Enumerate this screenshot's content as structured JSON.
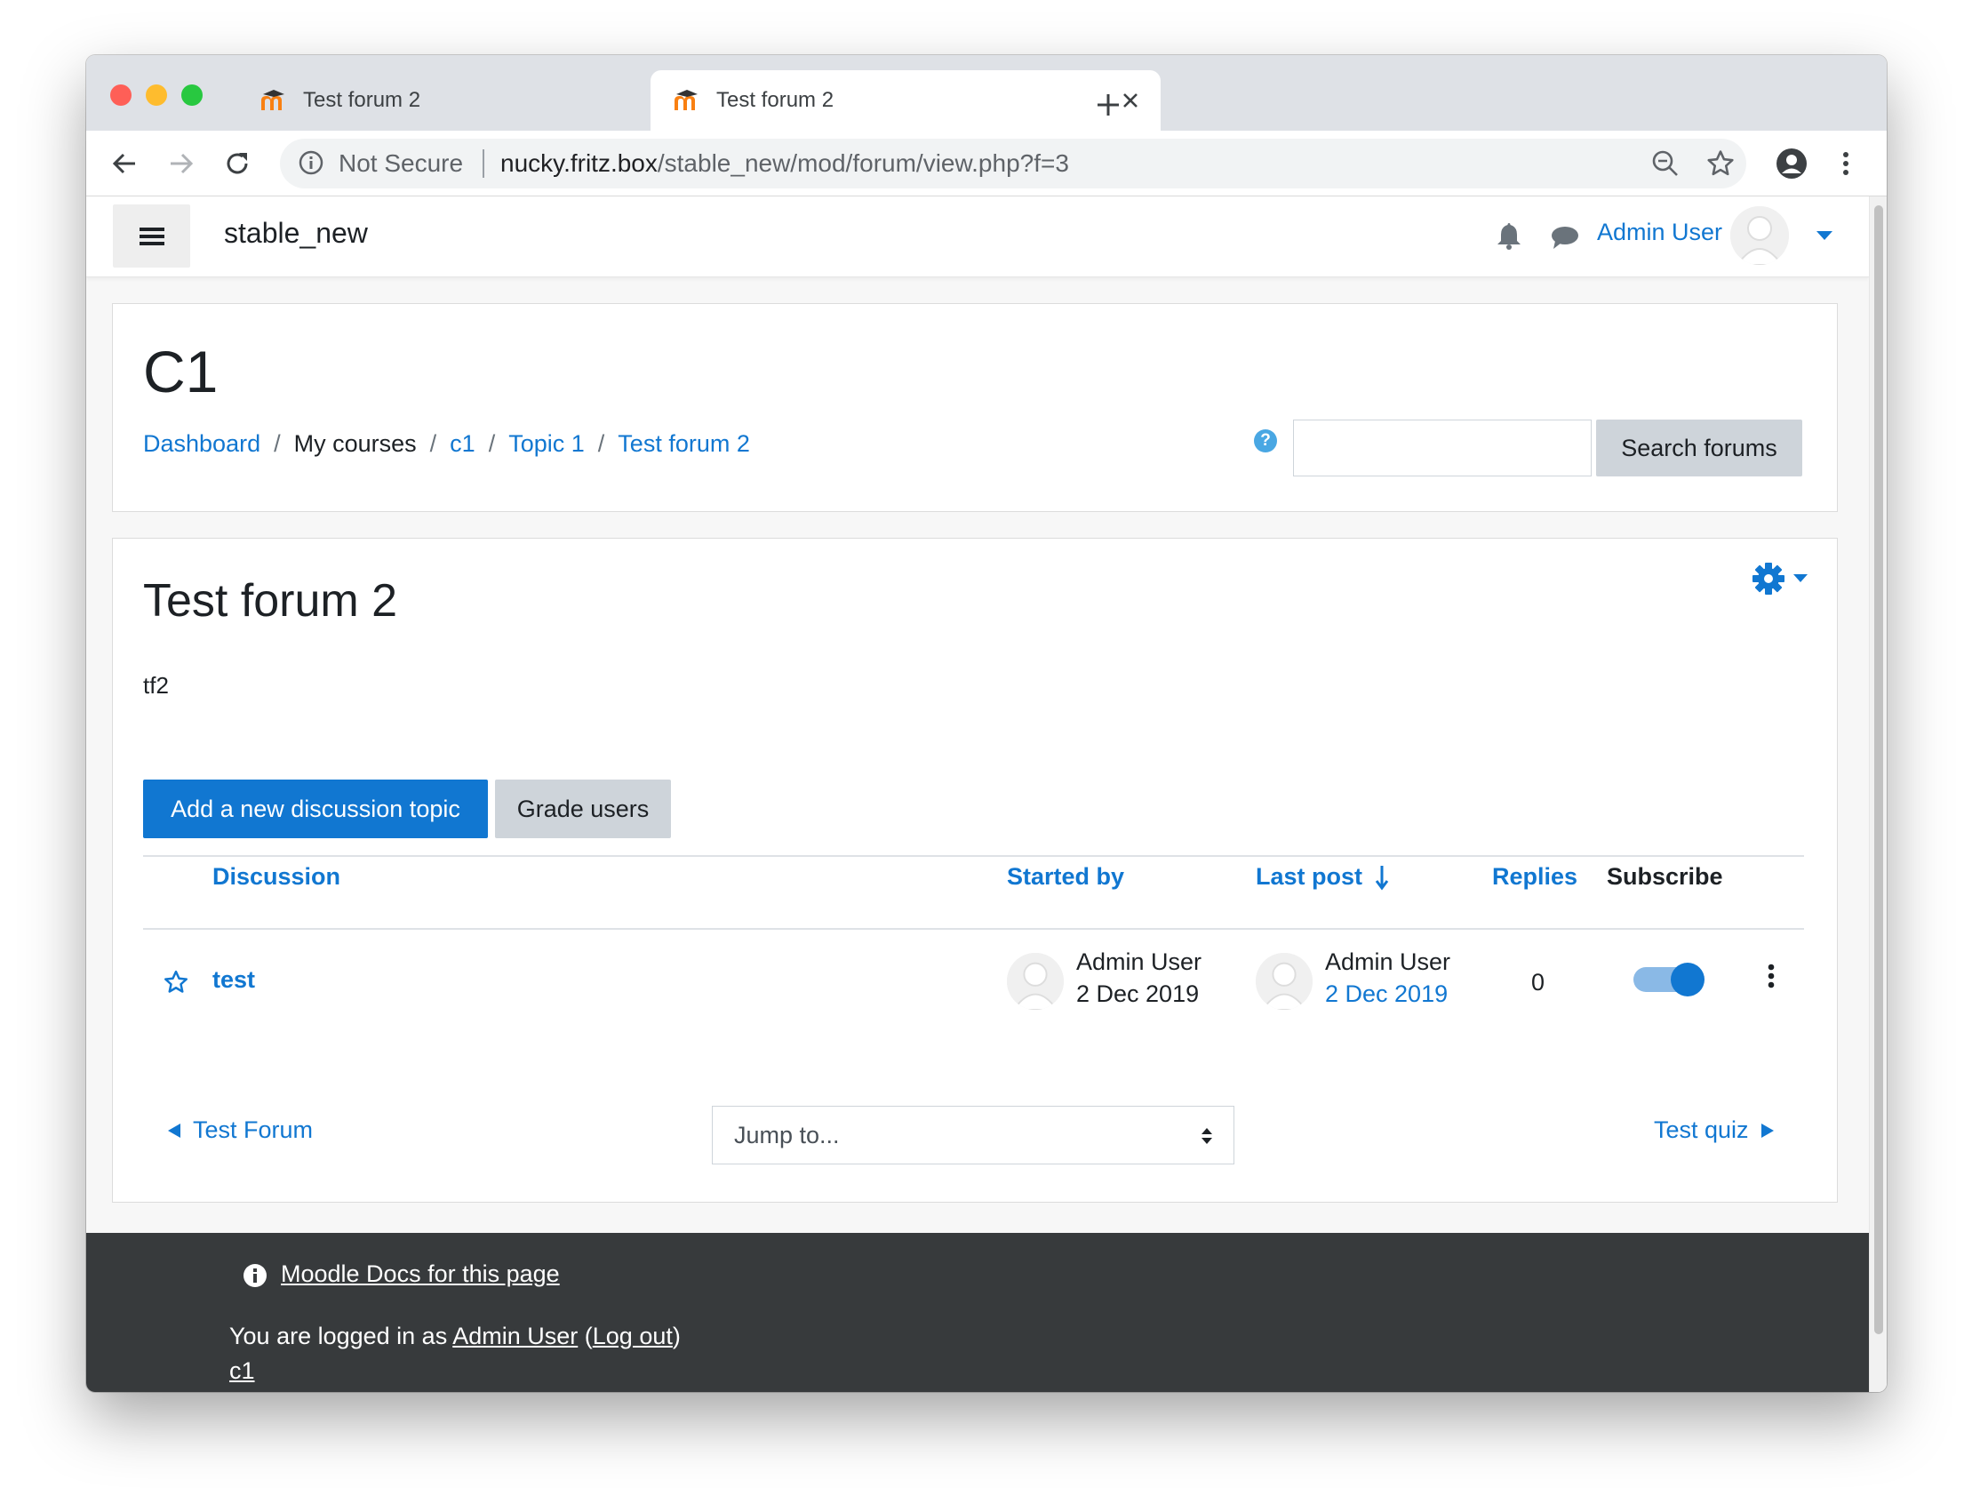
{
  "browser": {
    "tabs": [
      {
        "title": "Test forum 2"
      },
      {
        "title": "Test forum 2"
      }
    ],
    "address": {
      "security_label": "Not Secure",
      "host": "nucky.fritz.box",
      "path": "/stable_new/mod/forum/view.php?f=3"
    }
  },
  "navbar": {
    "site_name": "stable_new",
    "user_name": "Admin User"
  },
  "header": {
    "course_title": "C1",
    "breadcrumb": [
      "Dashboard",
      "My courses",
      "c1",
      "Topic 1",
      "Test forum 2"
    ],
    "search_button": "Search forums",
    "search_value": ""
  },
  "forum": {
    "title": "Test forum 2",
    "description": "tf2",
    "add_button": "Add a new discussion topic",
    "grade_button": "Grade users",
    "columns": {
      "discussion": "Discussion",
      "started_by": "Started by",
      "last_post": "Last post",
      "replies": "Replies",
      "subscribe": "Subscribe"
    },
    "discussions": [
      {
        "title": "test",
        "starter_name": "Admin User",
        "starter_date": "2 Dec 2019",
        "last_post_name": "Admin User",
        "last_post_date": "2 Dec 2019",
        "replies": "0",
        "subscribed": true
      }
    ],
    "prev_activity": "Test Forum",
    "jump_placeholder": "Jump to...",
    "next_activity": "Test quiz"
  },
  "footer": {
    "docs_link": "Moodle Docs for this page",
    "logged_prefix": "You are logged in as",
    "logged_user": "Admin User",
    "logout": "Log out",
    "course_link": "c1"
  },
  "colors": {
    "primary": "#1177d1",
    "footer_bg": "#373a3c"
  }
}
